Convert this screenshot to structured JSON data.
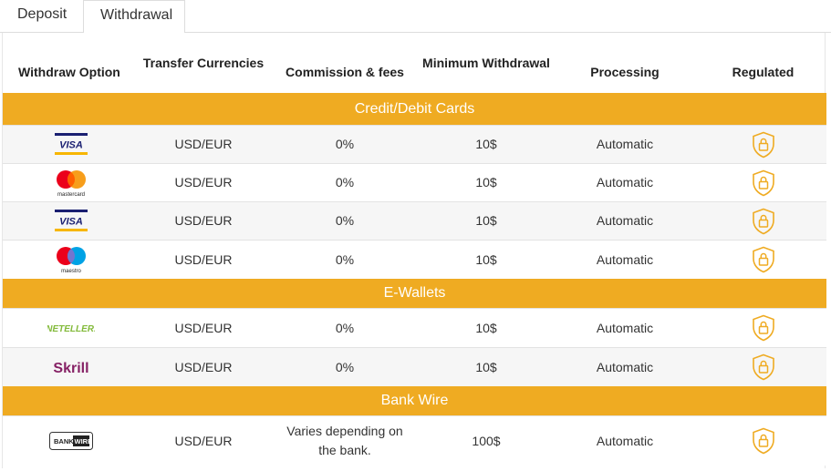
{
  "tabs": [
    {
      "label": "Deposit"
    },
    {
      "label": "Withdrawal",
      "active": true
    }
  ],
  "columns": {
    "withdraw_option": "Withdraw Option",
    "transfer_currencies": "Transfer Currencies",
    "commission": "Commission & fees",
    "minimum_withdrawal": "Minimum Withdrawal",
    "processing": "Processing",
    "regulated": "Regulated"
  },
  "sections": {
    "cards": "Credit/Debit Cards",
    "ewallets": "E-Wallets",
    "bankwire": "Bank Wire"
  },
  "rows": [
    {
      "logo": "visa-logo",
      "logo_text": "VISA",
      "currency": "USD/EUR",
      "commission": "0%",
      "minimum": "10$",
      "processing": "Automatic",
      "regulated_icon": "lock-shield-icon"
    },
    {
      "logo": "mastercard-logo",
      "logo_text": "mastercard",
      "currency": "USD/EUR",
      "commission": "0%",
      "minimum": "10$",
      "processing": "Automatic",
      "regulated_icon": "lock-shield-icon"
    },
    {
      "logo": "visa-logo",
      "logo_text": "VISA",
      "currency": "USD/EUR",
      "commission": "0%",
      "minimum": "10$",
      "processing": "Automatic",
      "regulated_icon": "lock-shield-icon"
    },
    {
      "logo": "maestro-logo",
      "logo_text": "maestro",
      "currency": "USD/EUR",
      "commission": "0%",
      "minimum": "10$",
      "processing": "Automatic",
      "regulated_icon": "lock-shield-icon"
    },
    {
      "logo": "neteller-logo",
      "logo_text": "NETELLER",
      "currency": "USD/EUR",
      "commission": "0%",
      "minimum": "10$",
      "processing": "Automatic",
      "regulated_icon": "lock-shield-icon"
    },
    {
      "logo": "skrill-logo",
      "logo_text": "Skrill",
      "currency": "USD/EUR",
      "commission": "0%",
      "minimum": "10$",
      "processing": "Automatic",
      "regulated_icon": "lock-shield-icon"
    },
    {
      "logo": "bankwire-logo",
      "logo_text": "BANKWIRE",
      "currency": "USD/EUR",
      "commission": "Varies depending on the bank.",
      "minimum": "100$",
      "processing": "Automatic",
      "regulated_icon": "lock-shield-icon"
    }
  ],
  "colors": {
    "section_bg": "#efab22",
    "shield": "#efab22",
    "visa_blue": "#1a1f71",
    "mc_red": "#eb001b",
    "mc_orange": "#f79e1b",
    "maestro_blue": "#00a2e5",
    "neteller_green": "#83ba3b",
    "skrill_purple": "#862165"
  }
}
